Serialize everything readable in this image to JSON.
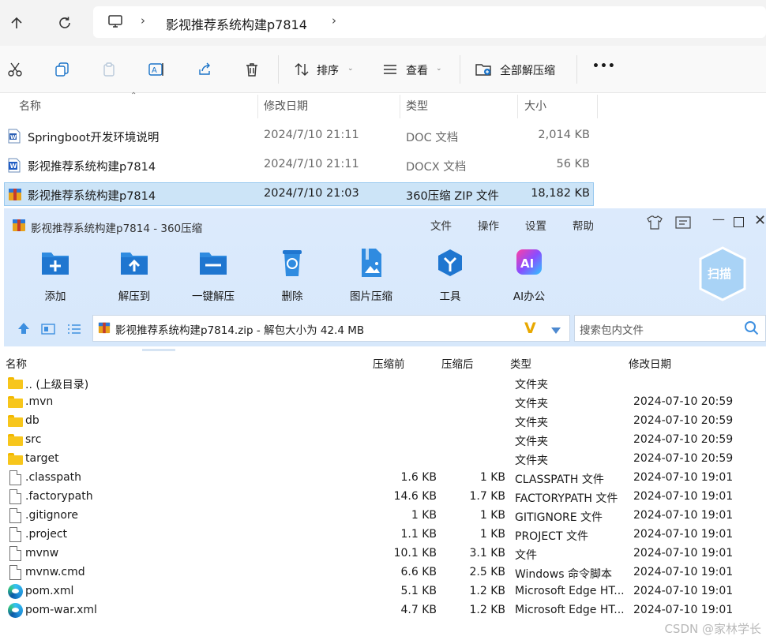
{
  "explorer": {
    "breadcrumb": {
      "folder": "影视推荐系统构建p7814"
    },
    "toolbar": {
      "sort_label": "排序",
      "view_label": "查看",
      "extract_all_label": "全部解压缩",
      "more_label": "•••"
    },
    "columns": {
      "name": "名称",
      "date": "修改日期",
      "type": "类型",
      "size": "大小"
    },
    "files": [
      {
        "name": "Springboot开发环境说明",
        "date": "2024/7/10 21:11",
        "type": "DOC 文档",
        "size": "2,014 KB",
        "icon": "word-doc-icon"
      },
      {
        "name": "影视推荐系统构建p7814",
        "date": "2024/7/10 21:11",
        "type": "DOCX 文档",
        "size": "56 KB",
        "icon": "word-docx-icon"
      },
      {
        "name": "影视推荐系统构建p7814",
        "date": "2024/7/10 21:03",
        "type": "360压缩 ZIP 文件",
        "size": "18,182 KB",
        "icon": "zip-archive-icon",
        "selected": true
      }
    ]
  },
  "zip": {
    "title": "影视推荐系统构建p7814 - 360压缩",
    "menu": [
      "文件",
      "操作",
      "设置",
      "帮助"
    ],
    "tools": [
      "添加",
      "解压到",
      "一键解压",
      "删除",
      "图片压缩",
      "工具",
      "AI办公"
    ],
    "scan_label": "扫描",
    "path": "影视推荐系统构建p7814.zip - 解包大小为 42.4 MB",
    "search_placeholder": "搜索包内文件",
    "columns": {
      "name": "名称",
      "before": "压缩前",
      "after": "压缩后",
      "type": "类型",
      "date": "修改日期"
    },
    "rows": [
      {
        "name": ".. (上级目录)",
        "before": "",
        "after": "",
        "type": "文件夹",
        "date": "",
        "icon": "folder"
      },
      {
        "name": ".mvn",
        "before": "",
        "after": "",
        "type": "文件夹",
        "date": "2024-07-10 20:59",
        "icon": "folder"
      },
      {
        "name": "db",
        "before": "",
        "after": "",
        "type": "文件夹",
        "date": "2024-07-10 20:59",
        "icon": "folder"
      },
      {
        "name": "src",
        "before": "",
        "after": "",
        "type": "文件夹",
        "date": "2024-07-10 20:59",
        "icon": "folder"
      },
      {
        "name": "target",
        "before": "",
        "after": "",
        "type": "文件夹",
        "date": "2024-07-10 20:59",
        "icon": "folder"
      },
      {
        "name": ".classpath",
        "before": "1.6 KB",
        "after": "1 KB",
        "type": "CLASSPATH 文件",
        "date": "2024-07-10 19:01",
        "icon": "doc"
      },
      {
        "name": ".factorypath",
        "before": "14.6 KB",
        "after": "1.7 KB",
        "type": "FACTORYPATH 文件",
        "date": "2024-07-10 19:01",
        "icon": "doc"
      },
      {
        "name": ".gitignore",
        "before": "1 KB",
        "after": "1 KB",
        "type": "GITIGNORE 文件",
        "date": "2024-07-10 19:01",
        "icon": "doc"
      },
      {
        "name": ".project",
        "before": "1.1 KB",
        "after": "1 KB",
        "type": "PROJECT 文件",
        "date": "2024-07-10 19:01",
        "icon": "doc"
      },
      {
        "name": "mvnw",
        "before": "10.1 KB",
        "after": "3.1 KB",
        "type": "文件",
        "date": "2024-07-10 19:01",
        "icon": "doc"
      },
      {
        "name": "mvnw.cmd",
        "before": "6.6 KB",
        "after": "2.5 KB",
        "type": "Windows 命令脚本",
        "date": "2024-07-10 19:01",
        "icon": "cmd"
      },
      {
        "name": "pom.xml",
        "before": "5.1 KB",
        "after": "1.2 KB",
        "type": "Microsoft Edge HT...",
        "date": "2024-07-10 19:01",
        "icon": "edge"
      },
      {
        "name": "pom-war.xml",
        "before": "4.7 KB",
        "after": "1.2 KB",
        "type": "Microsoft Edge HT...",
        "date": "2024-07-10 19:01",
        "icon": "edge"
      }
    ]
  },
  "watermark": "CSDN @家林学长"
}
